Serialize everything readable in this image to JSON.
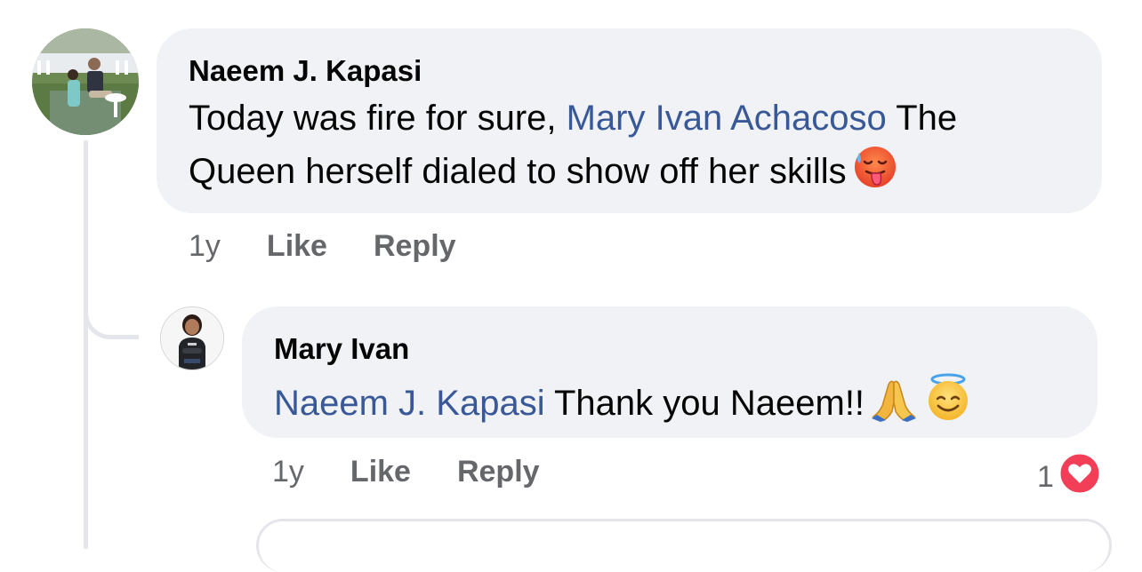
{
  "comment": {
    "author": "Naeem J. Kapasi",
    "text_before": "Today was fire for sure, ",
    "mention": "Mary Ivan Achacoso",
    "text_after": " The Queen herself dialed to show off her skills",
    "emoji": "hot-face-emoji",
    "time": "1y",
    "like_label": "Like",
    "reply_label": "Reply"
  },
  "reply": {
    "author": "Mary Ivan",
    "mention": "Naeem J. Kapasi",
    "text": " Thank you Naeem!!",
    "emojis": [
      "folded-hands-emoji",
      "smiling-face-with-halo-emoji"
    ],
    "time": "1y",
    "like_label": "Like",
    "reply_label": "Reply",
    "reaction_count": "1",
    "reaction_icon": "heart-reaction-icon"
  },
  "colors": {
    "bubble_bg": "#f0f2f5",
    "mention": "#385898",
    "secondary_text": "#65676b",
    "heart_reaction": "#f33e58"
  }
}
